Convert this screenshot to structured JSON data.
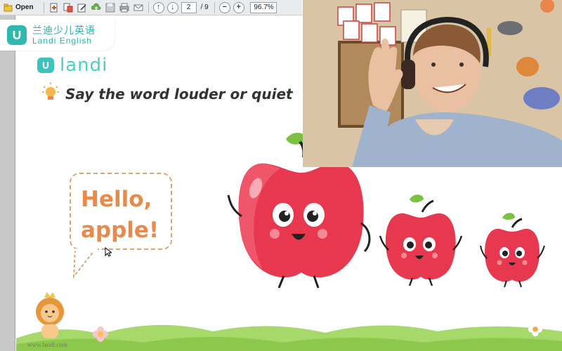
{
  "toolbar": {
    "open_label": "Open",
    "page_current": "2",
    "page_total": "/ 9",
    "zoom_value": "96.7%",
    "zoom_out_glyph": "−",
    "zoom_in_glyph": "+",
    "icons": [
      "open-icon",
      "export-icon",
      "convert-icon",
      "edit-icon",
      "upload-icon",
      "save-icon",
      "print-icon",
      "email-icon",
      "page-up-icon",
      "page-down-icon",
      "zoom-out-icon",
      "zoom-in-icon"
    ]
  },
  "brand_overlay": {
    "name_cn": "兰迪少儿英语",
    "name_en": "Landi English",
    "accent_color": "#2fb8b0"
  },
  "slide": {
    "logo_text": "landi",
    "instruction": "Say the word louder or quiet",
    "bubble_line1": "Hello,",
    "bubble_line2": "apple!",
    "website": "www.landi.com",
    "accent_orange": "#e98a4a",
    "apple_red": "#e8384f",
    "leaf_green": "#7cc242"
  },
  "webcam": {
    "description_icon": "teacher-webcam-feed"
  }
}
